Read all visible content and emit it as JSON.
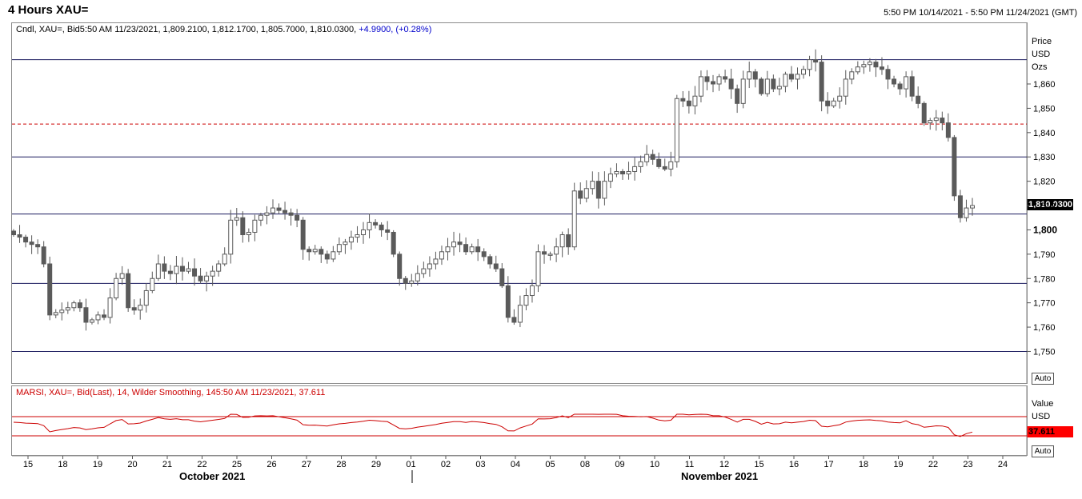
{
  "header": {
    "title": "4 Hours XAU=",
    "date_range": "5:50 PM 10/14/2021 - 5:50 PM 11/24/2021 (GMT)"
  },
  "info_line": {
    "text": "Cndl, XAU=, Bid5:50 AM 11/23/2021, 1,809.2100, 1,812.1700, 1,805.7000, 1,810.0300,",
    "change": "+4.9900, (+0.28%)"
  },
  "price_axis": {
    "label_price": "Price",
    "label_usd": "USD",
    "label_ozs": "Ozs",
    "auto": "Auto",
    "last_value": "1,810.0300"
  },
  "rsi": {
    "info": "MARSI, XAU=, Bid(Last),  14, Wilder Smoothing, 145:50 AM 11/23/2021, 37.611",
    "label_value": "Value",
    "label_usd": "USD",
    "last_value": "37.611",
    "auto": "Auto"
  },
  "x_axis": {
    "ticks": [
      "15",
      "18",
      "19",
      "20",
      "21",
      "22",
      "25",
      "26",
      "27",
      "28",
      "29",
      "01",
      "02",
      "03",
      "04",
      "05",
      "08",
      "09",
      "10",
      "11",
      "12",
      "15",
      "16",
      "17",
      "18",
      "19",
      "22",
      "23",
      "24"
    ],
    "months": [
      "October 2021",
      "November 2021"
    ]
  },
  "colors": {
    "candle": "#5a5a5a",
    "hline": "#1a1a5e",
    "dashed": "#cc0000",
    "rsi": "#cc0000",
    "tag_bg": "#000000",
    "rsi_tag_bg": "#ff0000"
  },
  "chart_data": {
    "type": "candlestick",
    "y_ticks": [
      "1,750",
      "1,760",
      "1,770",
      "1,780",
      "1,790",
      "1,800",
      "1,810",
      "1,820",
      "1,830",
      "1,840",
      "1,850",
      "1,860"
    ],
    "ylim": [
      1737,
      1885
    ],
    "horizontal_levels": [
      1870,
      1830,
      1806.5,
      1778,
      1750
    ],
    "dashed_level": 1843.5,
    "closes": [
      1798,
      1797,
      1795,
      1794,
      1793,
      1786,
      1765,
      1766,
      1767,
      1768,
      1770,
      1768,
      1762,
      1763,
      1765,
      1764,
      1772,
      1780,
      1782,
      1768,
      1767,
      1769,
      1775,
      1780,
      1786,
      1783,
      1782,
      1785,
      1783,
      1784,
      1781,
      1779,
      1781,
      1783,
      1786,
      1790,
      1804,
      1805,
      1798,
      1799,
      1804,
      1806,
      1807,
      1809,
      1808,
      1807,
      1806,
      1804,
      1792,
      1791,
      1792,
      1790,
      1788,
      1791,
      1794,
      1795,
      1797,
      1798,
      1800,
      1803,
      1802,
      1800,
      1799,
      1790,
      1780,
      1778,
      1779,
      1782,
      1784,
      1786,
      1788,
      1791,
      1793,
      1795,
      1794,
      1791,
      1793,
      1791,
      1789,
      1786,
      1784,
      1777,
      1764,
      1762,
      1769,
      1773,
      1777,
      1791,
      1790,
      1790,
      1793,
      1798,
      1793,
      1816,
      1813,
      1817,
      1820,
      1813,
      1820,
      1823,
      1824,
      1823,
      1824,
      1826,
      1828,
      1831,
      1829,
      1826,
      1825,
      1828,
      1854,
      1853,
      1851,
      1855,
      1863,
      1861,
      1860,
      1863,
      1862,
      1858,
      1852,
      1862,
      1865,
      1862,
      1856,
      1862,
      1858,
      1859,
      1864,
      1862,
      1864,
      1866,
      1870,
      1869,
      1853,
      1851,
      1853,
      1855,
      1862,
      1865,
      1867,
      1868,
      1869,
      1867,
      1866,
      1862,
      1860,
      1858,
      1863,
      1855,
      1852,
      1844,
      1845,
      1846,
      1844,
      1838,
      1814,
      1805,
      1809,
      1810
    ]
  }
}
